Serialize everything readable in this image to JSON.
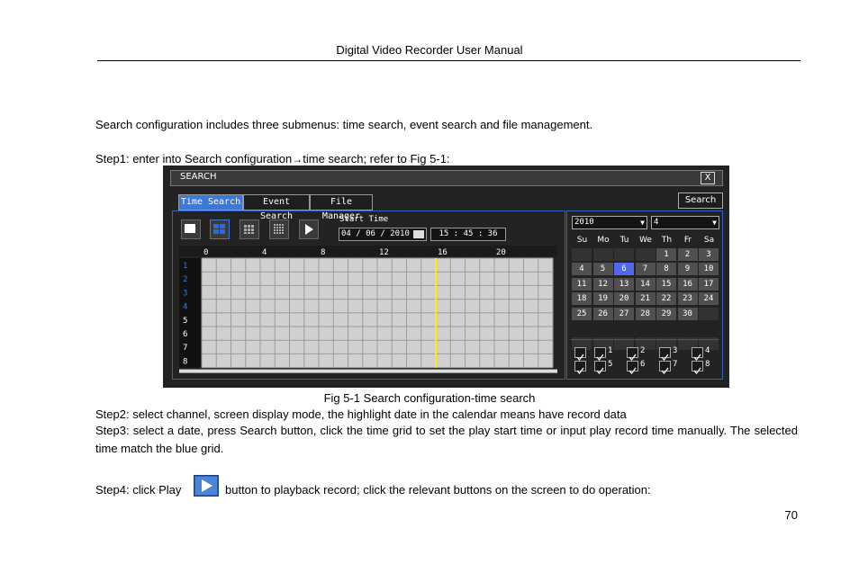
{
  "header": {
    "title": "Digital Video Recorder User Manual"
  },
  "body": {
    "intro": "Search configuration includes three submenus: time search, event search and file management.",
    "step1_a": "Step1: enter into Search configuration",
    "step1_b": "time search; refer to Fig 5-1:",
    "caption": "Fig 5-1 Search configuration-time search",
    "step2": "Step2: select channel, screen display mode, the highlight date in the calendar means have record data",
    "step3": "Step3: select a date, press Search button, click the time grid to set the play start time or input play record time manually. The selected time match the blue grid.",
    "step4_a": "Step4: click Play",
    "step4_b": "button to playback record; click the relevant buttons on the screen to do operation:",
    "page_number": "70"
  },
  "dvr": {
    "title": "SEARCH",
    "close": "X",
    "tabs": [
      "Time Search",
      "Event Search",
      "File Manager"
    ],
    "search_button": "Search",
    "start_time_label": "Start Time",
    "date_value": "04 / 06 / 2010",
    "time_value": "15  :  45  :  36",
    "hours": [
      "0",
      "4",
      "8",
      "12",
      "16",
      "20"
    ],
    "channels": [
      "1",
      "2",
      "3",
      "4",
      "5",
      "6",
      "7",
      "8"
    ],
    "marker_hour": 16,
    "calendar": {
      "year": "2010",
      "month": "4",
      "weekdays": [
        "Su",
        "Mo",
        "Tu",
        "We",
        "Th",
        "Fr",
        "Sa"
      ],
      "days": [
        "1",
        "2",
        "3",
        "4",
        "5",
        "6",
        "7",
        "8",
        "9",
        "10",
        "11",
        "12",
        "13",
        "14",
        "15",
        "16",
        "17",
        "18",
        "19",
        "20",
        "21",
        "22",
        "23",
        "24",
        "25",
        "26",
        "27",
        "28",
        "29",
        "30"
      ],
      "selected_day": "6"
    },
    "channel_checks": [
      "1",
      "2",
      "3",
      "4",
      "5",
      "6",
      "7",
      "8"
    ]
  },
  "colors": {
    "accent_blue": "#3d77d8",
    "marker_yellow": "#ffee00",
    "panel_border": "#3361c0"
  }
}
